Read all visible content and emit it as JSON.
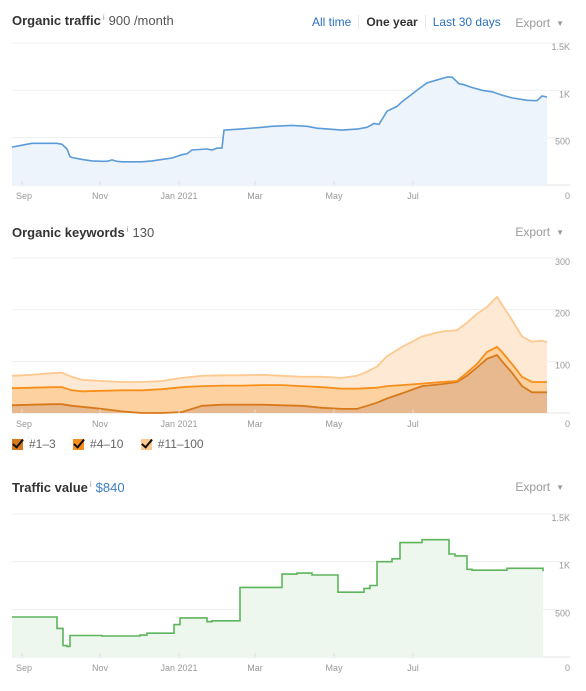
{
  "traffic": {
    "title": "Organic traffic",
    "info_icon": "i",
    "value": "900 /month",
    "ranges": [
      {
        "label": "All time",
        "active": false
      },
      {
        "label": "One year",
        "active": true
      },
      {
        "label": "Last 30 days",
        "active": false
      }
    ],
    "export_label": "Export",
    "caret": "▼"
  },
  "keywords": {
    "title": "Organic keywords",
    "info_icon": "i",
    "value": "130",
    "export_label": "Export",
    "caret": "▼",
    "legend": [
      {
        "label": "#1–3",
        "color": "#d77a1c",
        "checked": true
      },
      {
        "label": "#4–10",
        "color": "#f88f1a",
        "checked": true
      },
      {
        "label": "#11–100",
        "color": "#fdc990",
        "checked": true
      }
    ]
  },
  "value": {
    "title": "Traffic value",
    "info_icon": "i",
    "value": "$840",
    "export_label": "Export",
    "caret": "▼"
  },
  "chart_data": [
    {
      "type": "area",
      "title": "Organic traffic",
      "color": "#5b9bd9",
      "fill": "#eef4fc",
      "x_ticks": [
        "Sep",
        "Nov",
        "Jan 2021",
        "Mar",
        "May",
        "Jul"
      ],
      "y_ticks": [
        "1.5K",
        "1K",
        "500",
        "0"
      ],
      "ylim": [
        0,
        1500
      ],
      "grid": true,
      "x": [
        0,
        10,
        20,
        40,
        45,
        50,
        55,
        58,
        60,
        70,
        80,
        90,
        95,
        100,
        105,
        110,
        130,
        140,
        150,
        160,
        170,
        175,
        180,
        195,
        200,
        205,
        210,
        212,
        228,
        250,
        260,
        280,
        295,
        305,
        330,
        345,
        355,
        362,
        367,
        375,
        385,
        390,
        400,
        405,
        415,
        435,
        440,
        447,
        452,
        460,
        470,
        480,
        490,
        500,
        515,
        525,
        530,
        535
      ],
      "y": [
        400,
        420,
        440,
        440,
        440,
        430,
        380,
        300,
        290,
        270,
        255,
        250,
        250,
        265,
        250,
        245,
        245,
        255,
        270,
        285,
        320,
        330,
        370,
        380,
        370,
        390,
        390,
        580,
        590,
        610,
        620,
        630,
        620,
        600,
        580,
        590,
        610,
        650,
        640,
        780,
        830,
        880,
        960,
        1000,
        1080,
        1140,
        1140,
        1070,
        1060,
        1030,
        1000,
        985,
        950,
        920,
        895,
        890,
        940,
        930
      ]
    },
    {
      "type": "area",
      "title": "Organic keywords",
      "stacked": true,
      "x_ticks": [
        "Sep",
        "Nov",
        "Jan 2021",
        "Mar",
        "May",
        "Jul"
      ],
      "y_ticks": [
        "300",
        "200",
        "100",
        "0"
      ],
      "ylim": [
        0,
        300
      ],
      "grid": true,
      "x": [
        0,
        20,
        40,
        50,
        60,
        70,
        90,
        110,
        130,
        150,
        170,
        190,
        210,
        230,
        250,
        270,
        290,
        310,
        330,
        345,
        355,
        365,
        375,
        390,
        410,
        430,
        445,
        455,
        465,
        475,
        485,
        490,
        500,
        510,
        520,
        530,
        535
      ],
      "series": [
        {
          "name": "#1–3",
          "color": "#d77a1c",
          "fill": "#e8b88f",
          "values": [
            15,
            16,
            17,
            17,
            14,
            12,
            8,
            3,
            0,
            0,
            2,
            14,
            16,
            16,
            16,
            15,
            14,
            10,
            8,
            8,
            14,
            20,
            28,
            38,
            52,
            56,
            60,
            72,
            88,
            105,
            112,
            100,
            78,
            52,
            40,
            40,
            40
          ]
        },
        {
          "name": "#4–10",
          "color": "#f88f1a",
          "fill": "#fed2a0",
          "values": [
            48,
            49,
            50,
            50,
            44,
            42,
            43,
            44,
            44,
            46,
            50,
            52,
            53,
            53,
            54,
            54,
            52,
            50,
            47,
            47,
            48,
            49,
            52,
            54,
            57,
            60,
            62,
            78,
            95,
            118,
            128,
            118,
            95,
            70,
            60,
            60,
            60
          ]
        },
        {
          "name": "#11–100",
          "color": "#fdc990",
          "fill": "#feead4",
          "values": [
            72,
            74,
            77,
            78,
            70,
            64,
            62,
            60,
            60,
            62,
            68,
            72,
            73,
            73,
            74,
            72,
            70,
            70,
            68,
            72,
            80,
            90,
            110,
            128,
            148,
            158,
            160,
            175,
            192,
            205,
            225,
            210,
            180,
            148,
            138,
            140,
            137
          ]
        }
      ]
    },
    {
      "type": "area",
      "title": "Traffic value",
      "color": "#5cb55b",
      "fill": "#eef7ee",
      "x_ticks": [
        "Sep",
        "Nov",
        "Jan 2021",
        "Mar",
        "May",
        "Jul"
      ],
      "y_ticks": [
        "1.5K",
        "1K",
        "500",
        "0"
      ],
      "ylim": [
        0,
        1500
      ],
      "grid": true,
      "x": [
        0,
        43,
        45,
        49,
        51,
        53,
        55,
        58,
        60,
        90,
        128,
        135,
        157,
        162,
        165,
        168,
        177,
        185,
        192,
        195,
        200,
        203,
        228,
        231,
        250,
        270,
        285,
        290,
        296,
        300,
        323,
        326,
        330,
        347,
        352,
        355,
        358,
        360,
        365,
        372,
        380,
        385,
        388,
        410,
        430,
        437,
        443,
        452,
        455,
        460,
        490,
        495,
        530,
        531
      ],
      "y": [
        420,
        420,
        300,
        300,
        120,
        120,
        110,
        225,
        225,
        220,
        230,
        250,
        250,
        340,
        340,
        410,
        410,
        410,
        410,
        370,
        380,
        380,
        730,
        730,
        730,
        870,
        880,
        880,
        880,
        860,
        860,
        680,
        680,
        680,
        720,
        720,
        750,
        750,
        1000,
        1000,
        1030,
        1030,
        1200,
        1230,
        1230,
        1080,
        1060,
        1060,
        920,
        910,
        910,
        930,
        930,
        900
      ]
    }
  ]
}
